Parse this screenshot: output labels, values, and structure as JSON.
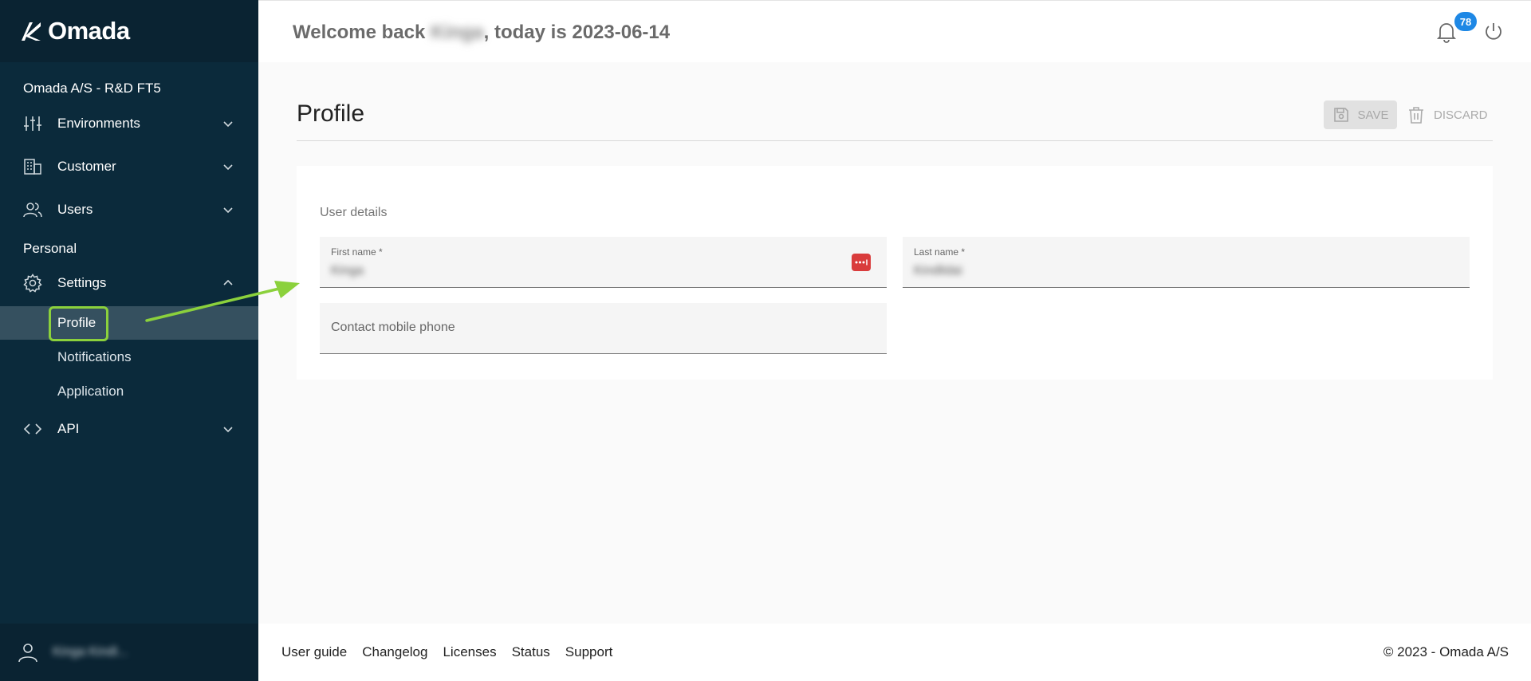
{
  "app": {
    "logo_text": "Omada"
  },
  "sidebar": {
    "org_name": "Omada A/S - R&D FT5",
    "items": [
      {
        "label": "Environments",
        "icon": "sliders-icon"
      },
      {
        "label": "Customer",
        "icon": "building-icon"
      },
      {
        "label": "Users",
        "icon": "users-icon"
      }
    ],
    "section_personal": "Personal",
    "settings": {
      "label": "Settings",
      "icon": "gear-icon"
    },
    "sub_items": [
      {
        "label": "Profile"
      },
      {
        "label": "Notifications"
      },
      {
        "label": "Application"
      }
    ],
    "api": {
      "label": "API",
      "icon": "code-icon"
    },
    "footer_user": "Kinga Kindl..."
  },
  "header": {
    "welcome_prefix": "Welcome back",
    "welcome_name": "Kinga",
    "welcome_suffix": ", today is 2023-06-14",
    "notification_count": "78"
  },
  "main": {
    "title": "Profile",
    "save_label": "SAVE",
    "discard_label": "DISCARD",
    "section_title": "User details",
    "first_name_label": "First name *",
    "first_name_value": "Kinga",
    "last_name_label": "Last name *",
    "last_name_value": "Kindlidai",
    "phone_placeholder": "Contact mobile phone"
  },
  "footer": {
    "links": [
      "User guide",
      "Changelog",
      "Licenses",
      "Status",
      "Support"
    ],
    "copyright": "© 2023 - Omada A/S"
  },
  "colors": {
    "sidebar_bg": "#0b2a3b",
    "accent_green": "#8bd13c",
    "badge_blue": "#1e88e5",
    "password_icon_red": "#d93c3c"
  }
}
